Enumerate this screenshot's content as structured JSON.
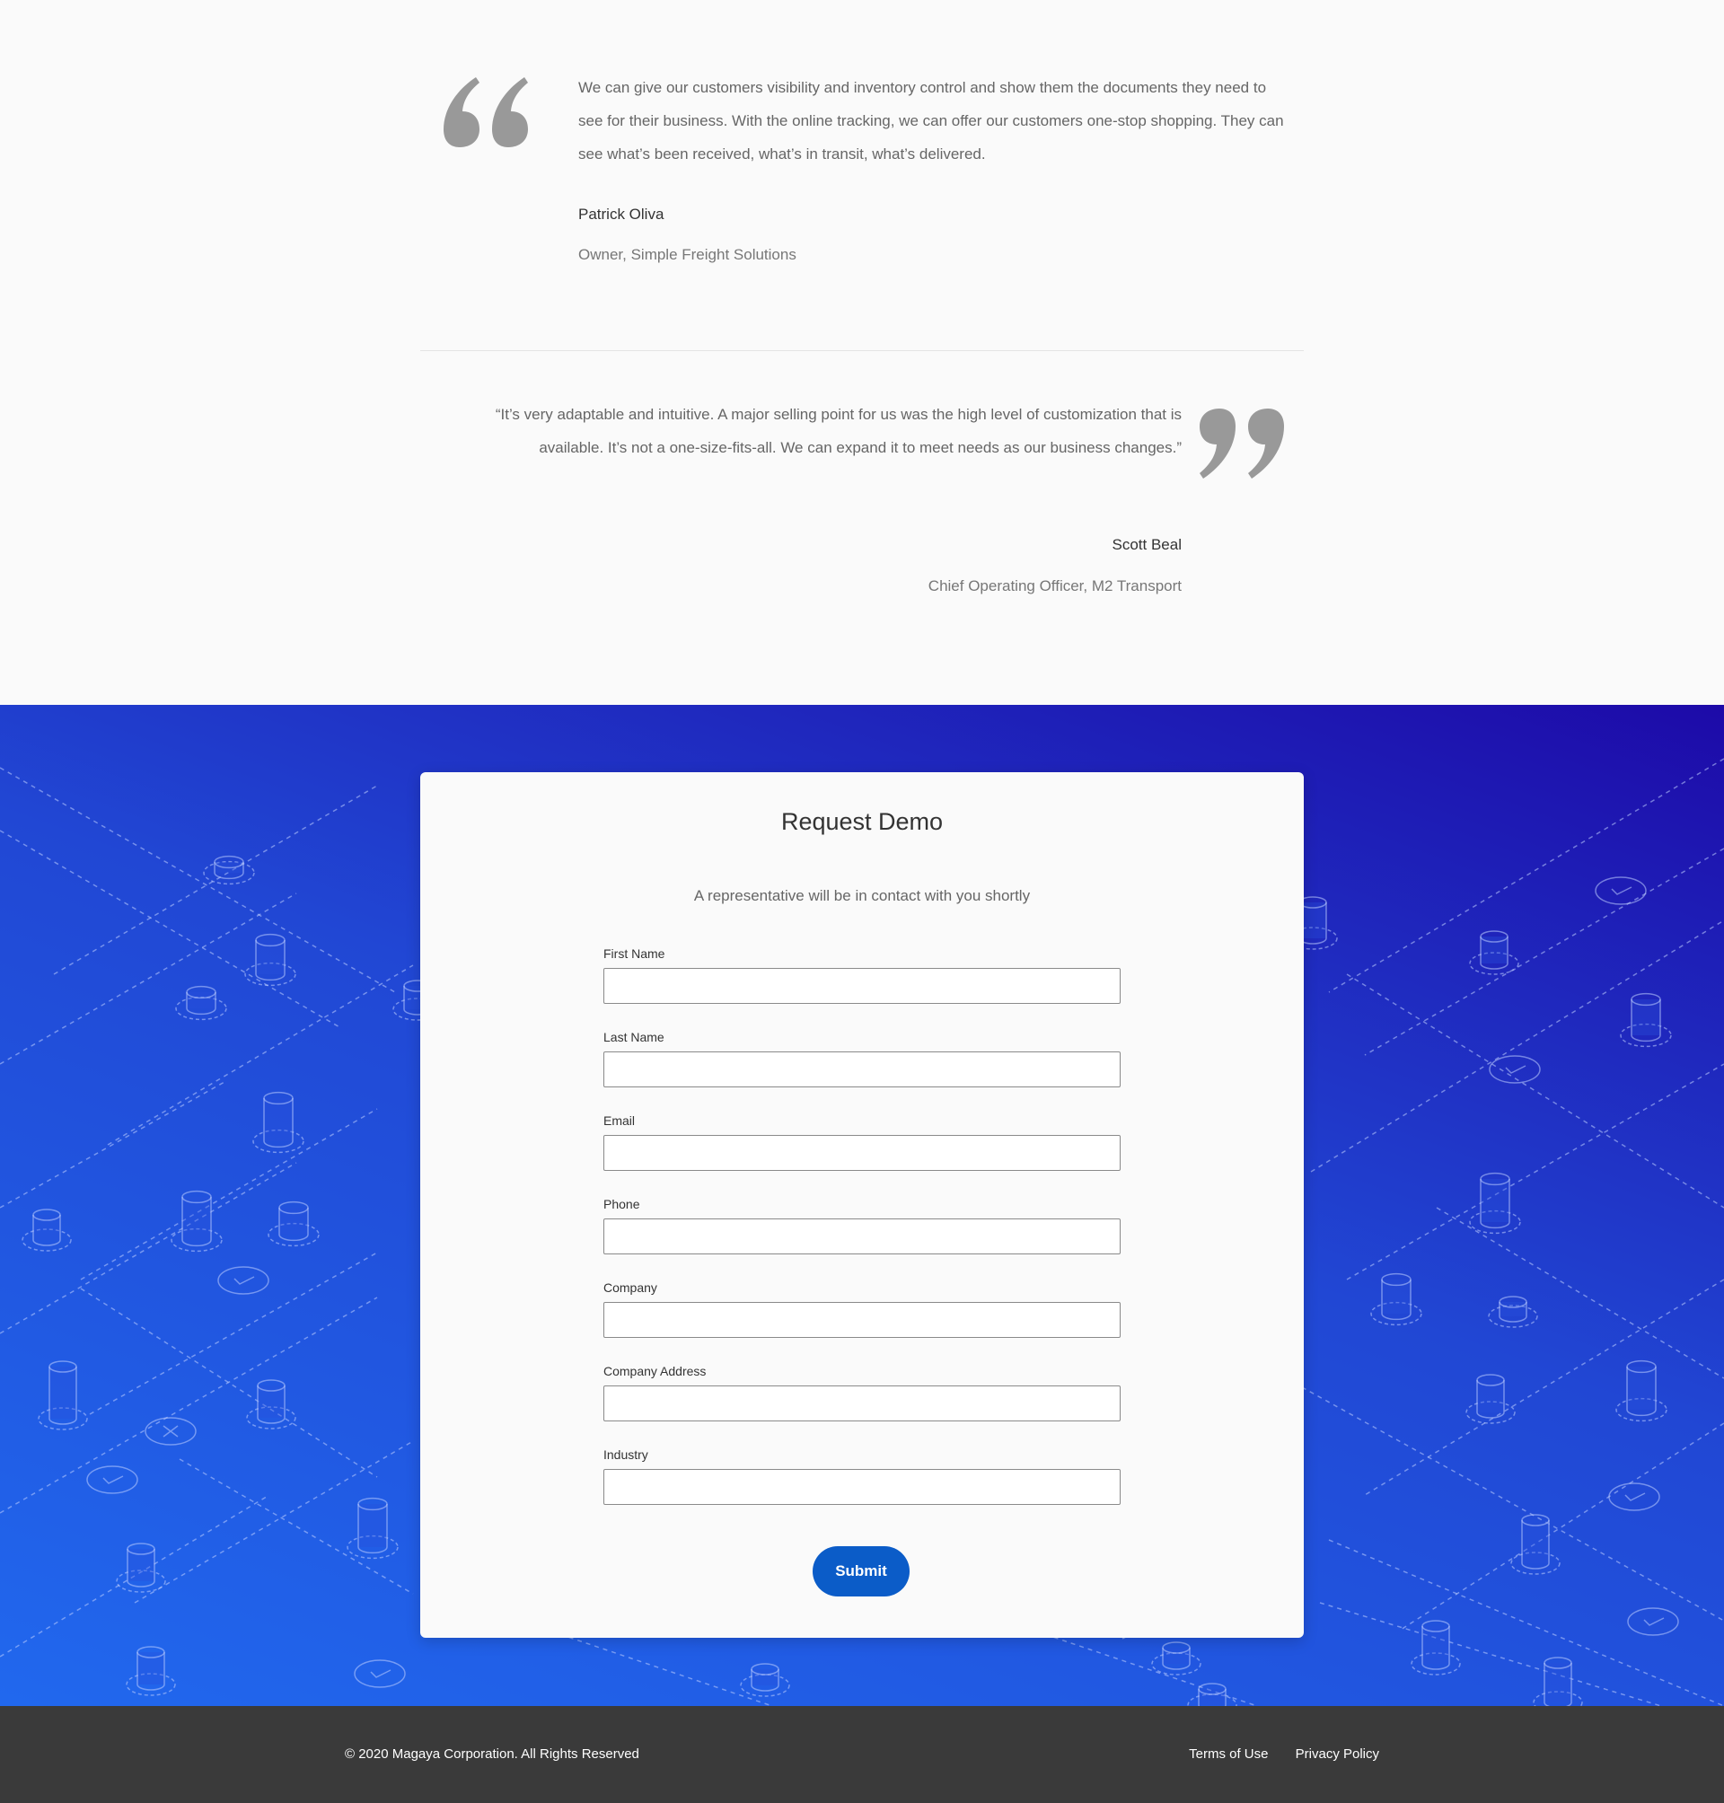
{
  "testimonials": [
    {
      "text": "We can give our customers visibility and inventory control and show them the documents they need to see for their business. With the online tracking, we can offer our customers one-stop shopping. They can see what’s been received, what’s in transit, what’s delivered.",
      "author": "Patrick Oliva",
      "role": "Owner, Simple Freight Solutions"
    },
    {
      "text": "“It’s very adaptable and intuitive. A major selling point for us was the high level of customization that is available. It’s not a one-size-fits-all. We can expand it to meet needs as our business changes.”",
      "author": "Scott Beal",
      "role": "Chief Operating Officer, M2 Transport"
    }
  ],
  "demo_form": {
    "title": "Request Demo",
    "subtitle": "A representative will be in contact with you shortly",
    "fields": [
      {
        "label": "First Name",
        "value": ""
      },
      {
        "label": "Last Name",
        "value": ""
      },
      {
        "label": "Email",
        "value": ""
      },
      {
        "label": "Phone",
        "value": ""
      },
      {
        "label": "Company",
        "value": ""
      },
      {
        "label": "Company Address",
        "value": ""
      },
      {
        "label": "Industry",
        "value": ""
      }
    ],
    "submit_label": "Submit"
  },
  "footer": {
    "copyright": "© 2020 Magaya Corporation. All Rights Reserved",
    "links": [
      "Terms of Use",
      "Privacy Policy"
    ]
  },
  "colors": {
    "quote_mark": "#999999",
    "gradient_top": "#1d0aa8",
    "gradient_bottom": "#2168ee",
    "submit_button": "#0b5cc8",
    "footer_bg": "#3a3a3a"
  },
  "icons": [
    "open-quote-icon",
    "close-quote-icon",
    "cylinder-icon",
    "check-circle-icon"
  ]
}
